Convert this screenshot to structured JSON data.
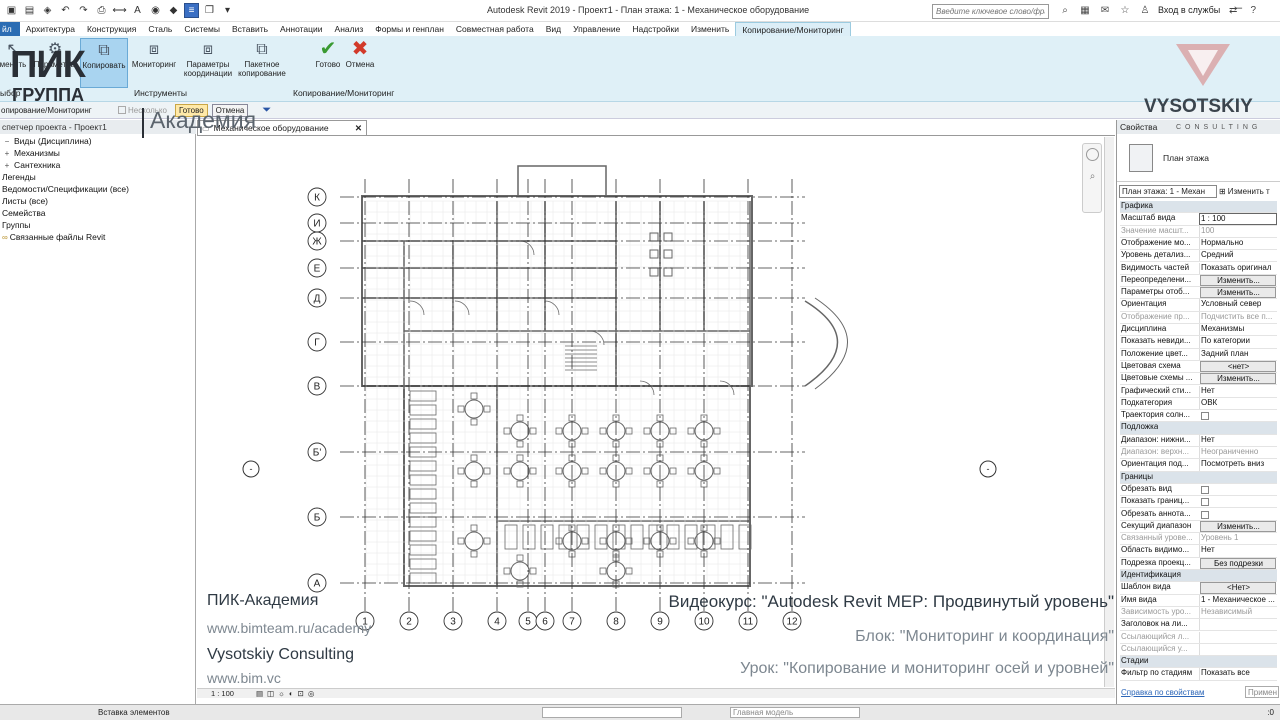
{
  "titlebar": {
    "app_title": "Autodesk Revit 2019 - Проект1 - План этажа: 1 - Механическое оборудование",
    "search_placeholder": "Введите ключевое слово/фразу",
    "signin": "Вход в службы"
  },
  "tabs": [
    "йл",
    "Архитектура",
    "Конструкция",
    "Сталь",
    "Системы",
    "Вставить",
    "Аннотации",
    "Анализ",
    "Формы и генплан",
    "Совместная работа",
    "Вид",
    "Управление",
    "Надстройки",
    "Изменить",
    "Копирование/Мониторинг"
  ],
  "ribbon": {
    "buttons": [
      {
        "label": "менить"
      },
      {
        "label": "Параметры"
      },
      {
        "label": "Копировать"
      },
      {
        "label": "Мониторинг"
      },
      {
        "label": "Параметры координации"
      },
      {
        "label": "Пакетное копирование"
      },
      {
        "label": "Готово"
      },
      {
        "label": "Отмена"
      }
    ],
    "panel_select": "ыбор",
    "panel_tools": "Инструменты",
    "panel_copymon": "Копирование/Мониторинг"
  },
  "optbar": {
    "context": "опирование/Мониторинг",
    "multiple": "Несколько",
    "finish": "Готово",
    "cancel": "Отмена"
  },
  "browser": {
    "title": "спетчер проекта - Проект1",
    "items": [
      {
        "toggle": "−",
        "label": "Виды (Дисциплина)",
        "indent": 0
      },
      {
        "toggle": "+",
        "label": "Механизмы",
        "indent": 1
      },
      {
        "toggle": "+",
        "label": "Сантехника",
        "indent": 1
      },
      {
        "toggle": "",
        "label": "Легенды",
        "indent": 0
      },
      {
        "toggle": "",
        "label": "Ведомости/Спецификации (все)",
        "indent": 0
      },
      {
        "toggle": "",
        "label": "Листы (все)",
        "indent": 0
      },
      {
        "toggle": "",
        "label": "Семейства",
        "indent": 0
      },
      {
        "toggle": "",
        "label": "Группы",
        "indent": 0
      },
      {
        "toggle": "",
        "label": "Связанные файлы Revit",
        "indent": 0
      }
    ]
  },
  "view": {
    "tab_label": "Механическое оборудование",
    "scale": "1 : 100",
    "grid_rows": [
      "К",
      "И",
      "Ж",
      "Е",
      "Д",
      "Г",
      "В",
      "Б'",
      "Б",
      "А"
    ],
    "grid_cols": [
      "1",
      "2",
      "3",
      "4",
      "5",
      "6",
      "7",
      "8",
      "9",
      "10",
      "11",
      "12"
    ],
    "elev_markers": [
      "-",
      "-"
    ]
  },
  "properties": {
    "title": "Свойства",
    "type_name": "План этажа",
    "selector": "План этажа: 1 - Механ",
    "edit_type": "Изменить т",
    "rows": [
      {
        "k": "Графика",
        "group": true
      },
      {
        "k": "Масштаб вида",
        "v": "1 : 100",
        "style": "inp"
      },
      {
        "k": "Значение масшт...",
        "v": "100",
        "dim": true
      },
      {
        "k": "Отображение мо...",
        "v": "Нормально"
      },
      {
        "k": "Уровень детализ...",
        "v": "Средний"
      },
      {
        "k": "Видимость частей",
        "v": "Показать оригинал"
      },
      {
        "k": "Переопределени...",
        "v": "Изменить...",
        "style": "btn"
      },
      {
        "k": "Параметры отоб...",
        "v": "Изменить...",
        "style": "btn"
      },
      {
        "k": "Ориентация",
        "v": "Условный север"
      },
      {
        "k": "Отображение пр...",
        "v": "Подчистить все п...",
        "dim": true
      },
      {
        "k": "Дисциплина",
        "v": "Механизмы"
      },
      {
        "k": "Показать невиди...",
        "v": "По категории"
      },
      {
        "k": "Положение цвет...",
        "v": "Задний план"
      },
      {
        "k": "Цветовая схема",
        "v": "<нет>",
        "style": "btn"
      },
      {
        "k": "Цветовые схемы ...",
        "v": "Изменить...",
        "style": "btn"
      },
      {
        "k": "Графический сти...",
        "v": "Нет"
      },
      {
        "k": "Подкатегория",
        "v": "ОВК"
      },
      {
        "k": "Траектория солн...",
        "v": "",
        "style": "cb"
      },
      {
        "k": "Подложка",
        "group": true
      },
      {
        "k": "Диапазон: нижни...",
        "v": "Нет"
      },
      {
        "k": "Диапазон: верхн...",
        "v": "Неограниченно",
        "dim": true
      },
      {
        "k": "Ориентация под...",
        "v": "Посмотреть вниз"
      },
      {
        "k": "Границы",
        "group": true
      },
      {
        "k": "Обрезать вид",
        "v": "",
        "style": "cb"
      },
      {
        "k": "Показать границ...",
        "v": "",
        "style": "cb"
      },
      {
        "k": "Обрезать аннота...",
        "v": "",
        "style": "cb"
      },
      {
        "k": "Секущий диапазон",
        "v": "Изменить...",
        "style": "btn"
      },
      {
        "k": "Связанный урове...",
        "v": "Уровень 1",
        "dim": true
      },
      {
        "k": "Область видимо...",
        "v": "Нет"
      },
      {
        "k": "Подрезка проекц...",
        "v": "Без подрезки",
        "style": "btn"
      },
      {
        "k": "Идентификация",
        "group": true
      },
      {
        "k": "Шаблон вида",
        "v": "<Нет>",
        "style": "btn"
      },
      {
        "k": "Имя вида",
        "v": "1 - Механическое ..."
      },
      {
        "k": "Зависимость уро...",
        "v": "Независимый",
        "dim": true
      },
      {
        "k": "Заголовок на ли...",
        "v": ""
      },
      {
        "k": "Ссылающийся л...",
        "v": "",
        "dim": true
      },
      {
        "k": "Ссылающийся у...",
        "v": "",
        "dim": true
      },
      {
        "k": "Стадии",
        "group": true
      },
      {
        "k": "Фильтр по стадиям",
        "v": "Показать все"
      }
    ],
    "help_link": "Справка по свойствам",
    "apply": "Примен"
  },
  "status": {
    "text": "Вставка элементов",
    "model": "Главная модель",
    "filter_count": ":0"
  },
  "overlay": {
    "pik_big": "ПИК",
    "pik_group": "ГРУППА",
    "akademia": "Академия",
    "vys_name": "VYSOTSKIY",
    "vys_sub": "CONSULTING",
    "left_lines": [
      "ПИК-Академия",
      "www.bimteam.ru/academy",
      "Vysotskiy Consulting",
      "www.bim.vc"
    ],
    "course": "Видеокурс: \"Autodesk Revit MEP: Продвинутый уровень\"",
    "block": "Блок: \"Мониторинг и координация\"",
    "lesson": "Урок: \"Копирование и мониторинг осей и уровней\""
  }
}
